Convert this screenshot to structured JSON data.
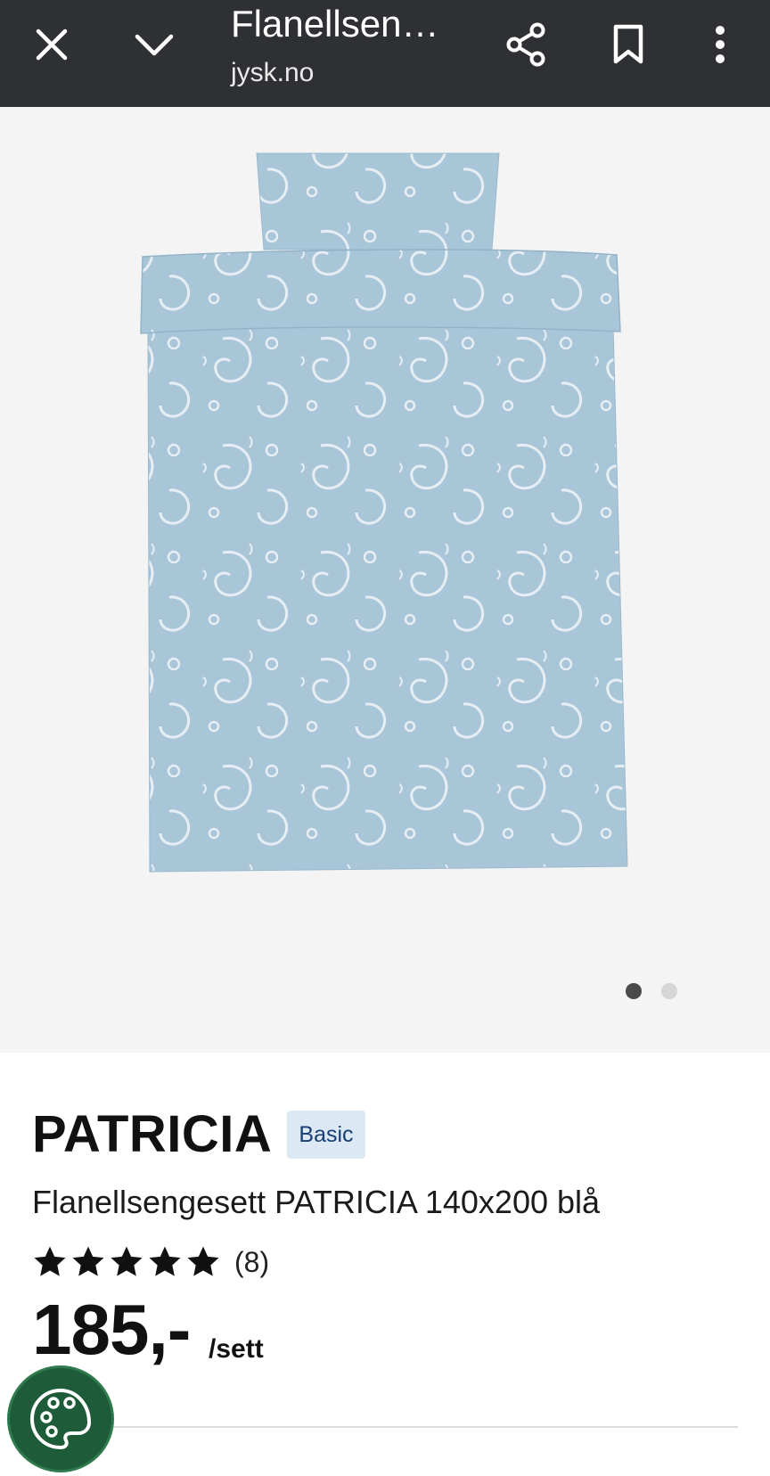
{
  "topbar": {
    "title": "Flanellsen…",
    "url": "jysk.no",
    "icons": {
      "close": "close-icon",
      "minimize": "chevron-down-icon",
      "share": "share-icon",
      "bookmark": "bookmark-icon",
      "menu": "more-vert-icon"
    }
  },
  "gallery": {
    "image_count": 2,
    "active_index": 0,
    "colors": {
      "background": "#f4f4f4",
      "fabric": "#a9c6d9",
      "pattern": "#e6eef4"
    }
  },
  "product": {
    "brand": "PATRICIA",
    "badge": "Basic",
    "subtitle": "Flanellsengesett PATRICIA 140x200 blå",
    "rating": 5,
    "rating_max": 5,
    "review_count": "(8)",
    "price": "185,-",
    "unit": "/sett"
  },
  "cookie": {
    "icon": "cookie-palette-icon",
    "color": "#1e5b38"
  }
}
